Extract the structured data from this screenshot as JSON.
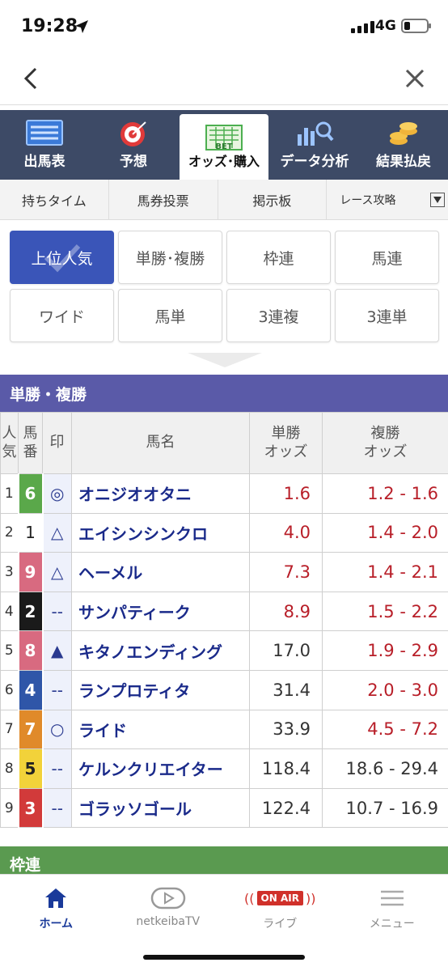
{
  "status": {
    "time": "19:28",
    "network": "4G"
  },
  "main_tabs": [
    {
      "label": "出馬表",
      "icon": "list-icon",
      "active": false
    },
    {
      "label": "予想",
      "icon": "target-icon",
      "active": false
    },
    {
      "label": "オッズ･購入",
      "icon": "bet-sheet-icon",
      "active": true
    },
    {
      "label": "データ分析",
      "icon": "chart-search-icon",
      "active": false
    },
    {
      "label": "結果払戻",
      "icon": "coins-icon",
      "active": false
    }
  ],
  "sub_tabs": [
    "持ちタイム",
    "馬券投票",
    "掲示板",
    "レース攻略"
  ],
  "filters": [
    {
      "label": "上位人気",
      "active": true
    },
    {
      "label": "単勝･複勝",
      "active": false
    },
    {
      "label": "枠連",
      "active": false
    },
    {
      "label": "馬連",
      "active": false
    },
    {
      "label": "ワイド",
      "active": false
    },
    {
      "label": "馬単",
      "active": false
    },
    {
      "label": "3連複",
      "active": false
    },
    {
      "label": "3連単",
      "active": false
    }
  ],
  "section_title": "単勝・複勝",
  "table": {
    "headers": {
      "rank": "人気",
      "num": "馬番",
      "mark": "印",
      "name": "馬名",
      "win": "単勝オッズ",
      "place": "複勝オッズ"
    },
    "header_lines": {
      "rank_a": "人",
      "rank_b": "気",
      "num_a": "馬",
      "num_b": "番",
      "win_a": "単勝",
      "win_b": "オッズ",
      "place_a": "複勝",
      "place_b": "オッズ"
    },
    "rows": [
      {
        "rank": "1",
        "num": "6",
        "color": "#5aa84a",
        "mark": "◎",
        "name": "オニジオオタニ",
        "win": "1.6",
        "place": "1.2 - 1.6",
        "win_red": true,
        "place_red": true
      },
      {
        "rank": "2",
        "num": "1",
        "color": "#ffffff",
        "mark": "△",
        "name": "エイシンシンクロ",
        "win": "4.0",
        "place": "1.4 - 2.0",
        "win_red": true,
        "place_red": true
      },
      {
        "rank": "3",
        "num": "9",
        "color": "#d86a80",
        "mark": "△",
        "name": "ヘーメル",
        "win": "7.3",
        "place": "1.4 - 2.1",
        "win_red": true,
        "place_red": true
      },
      {
        "rank": "4",
        "num": "2",
        "color": "#1a1a1a",
        "mark": "--",
        "name": "サンパティーク",
        "win": "8.9",
        "place": "1.5 - 2.2",
        "win_red": true,
        "place_red": true
      },
      {
        "rank": "5",
        "num": "8",
        "color": "#d86a80",
        "mark": "▲",
        "name": "キタノエンディング",
        "win": "17.0",
        "place": "1.9 - 2.9",
        "win_red": false,
        "place_red": true
      },
      {
        "rank": "6",
        "num": "4",
        "color": "#2f56a8",
        "mark": "--",
        "name": "ランプロティタ",
        "win": "31.4",
        "place": "2.0 - 3.0",
        "win_red": false,
        "place_red": true
      },
      {
        "rank": "7",
        "num": "7",
        "color": "#e08a2a",
        "mark": "○",
        "name": "ライド",
        "win": "33.9",
        "place": "4.5 - 7.2",
        "win_red": false,
        "place_red": true
      },
      {
        "rank": "8",
        "num": "5",
        "color": "#f2d23a",
        "mark": "--",
        "name": "ケルンクリエイター",
        "win": "118.4",
        "place": "18.6 - 29.4",
        "win_red": false,
        "place_red": false
      },
      {
        "rank": "9",
        "num": "3",
        "color": "#d23a3a",
        "mark": "--",
        "name": "ゴラッソゴール",
        "win": "122.4",
        "place": "10.7 - 16.9",
        "win_red": false,
        "place_red": false
      }
    ]
  },
  "next_section_title": "枠連",
  "bottom_nav": [
    {
      "label": "ホーム",
      "icon": "home-icon",
      "active": true
    },
    {
      "label": "netkeibaTV",
      "icon": "tv-play-icon",
      "active": false
    },
    {
      "label": "ライブ",
      "icon": "on-air-icon",
      "badge": "ON AIR",
      "active": false
    },
    {
      "label": "メニュー",
      "icon": "menu-icon",
      "active": false
    }
  ],
  "colors": {
    "accent": "#3a55b8",
    "header_bg": "#3d4a66",
    "section_blue": "#5a5aa8",
    "section_green": "#5a9a50",
    "odds_red": "#b81e28"
  }
}
